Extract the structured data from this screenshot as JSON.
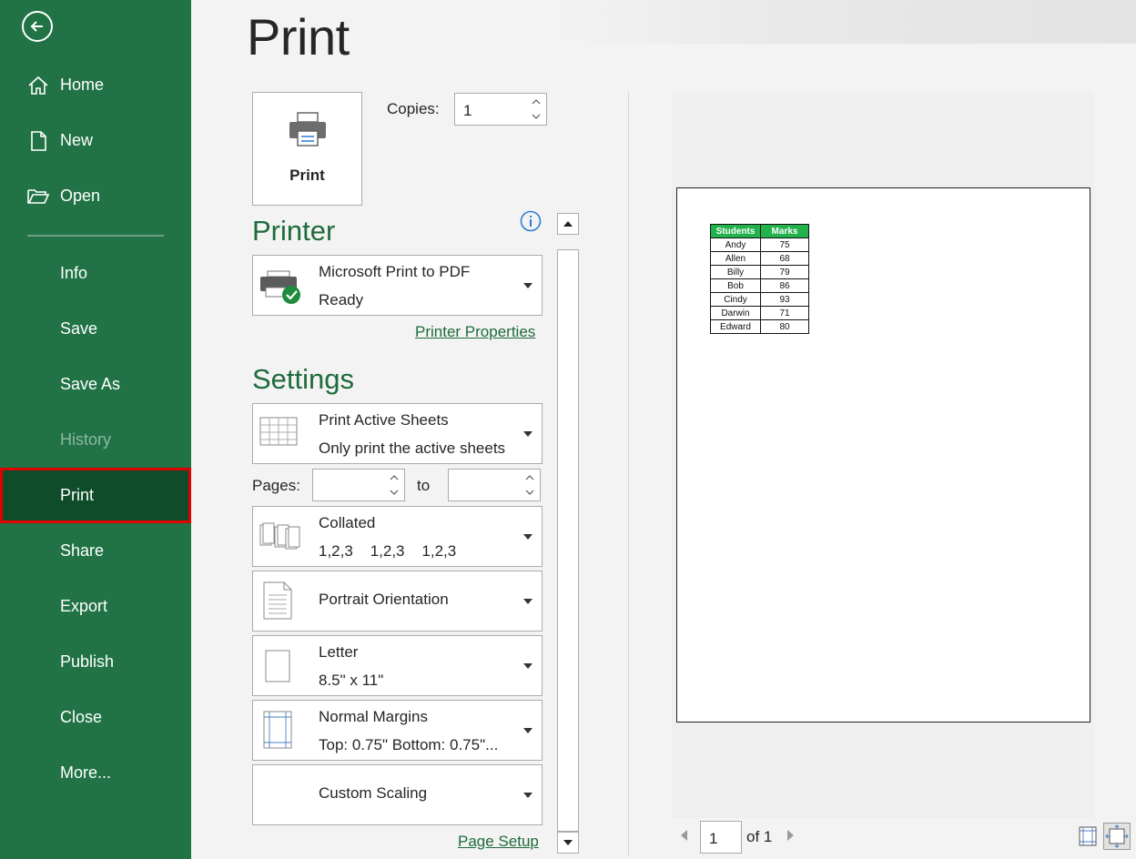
{
  "sidebar": {
    "back_icon": "back-arrow-icon",
    "items": [
      {
        "label": "Home",
        "icon": "home-icon"
      },
      {
        "label": "New",
        "icon": "new-document-icon"
      },
      {
        "label": "Open",
        "icon": "folder-open-icon"
      },
      {
        "label": "Info"
      },
      {
        "label": "Save"
      },
      {
        "label": "Save As"
      },
      {
        "label": "History",
        "state": "disabled"
      },
      {
        "label": "Print",
        "state": "selected"
      },
      {
        "label": "Share"
      },
      {
        "label": "Export"
      },
      {
        "label": "Publish"
      },
      {
        "label": "Close"
      },
      {
        "label": "More..."
      }
    ],
    "colors": {
      "background": "#217346",
      "selected": "#0e4c2a",
      "highlight_outline": "#e00000"
    }
  },
  "page_title": "Print",
  "print_button": {
    "label": "Print",
    "icon": "printer-icon"
  },
  "copies": {
    "label": "Copies:",
    "value": "1"
  },
  "printer": {
    "section_title": "Printer",
    "info_icon": "info-icon",
    "name": "Microsoft Print to PDF",
    "status": "Ready",
    "properties_link": "Printer Properties"
  },
  "settings": {
    "section_title": "Settings",
    "print_what": {
      "title": "Print Active Sheets",
      "subtitle": "Only print the active sheets"
    },
    "pages": {
      "label": "Pages:",
      "to_label": "to",
      "from_value": "",
      "to_value": ""
    },
    "collation": {
      "title": "Collated",
      "subtitle": "1,2,3    1,2,3    1,2,3"
    },
    "orientation": {
      "title": "Portrait Orientation"
    },
    "paper": {
      "title": "Letter",
      "subtitle": "8.5\" x 11\""
    },
    "margins": {
      "title": "Normal Margins",
      "subtitle": "Top: 0.75\" Bottom: 0.75\"..."
    },
    "scaling": {
      "title": "Custom Scaling"
    },
    "page_setup_link": "Page Setup"
  },
  "preview": {
    "table": {
      "headers": [
        "Students",
        "Marks"
      ],
      "rows": [
        [
          "Andy",
          "75"
        ],
        [
          "Allen",
          "68"
        ],
        [
          "Billy",
          "79"
        ],
        [
          "Bob",
          "86"
        ],
        [
          "Cindy",
          "93"
        ],
        [
          "Darwin",
          "71"
        ],
        [
          "Edward",
          "80"
        ]
      ],
      "header_color": "#22b24c"
    },
    "pager": {
      "current": "1",
      "of_label": "of 1"
    }
  }
}
